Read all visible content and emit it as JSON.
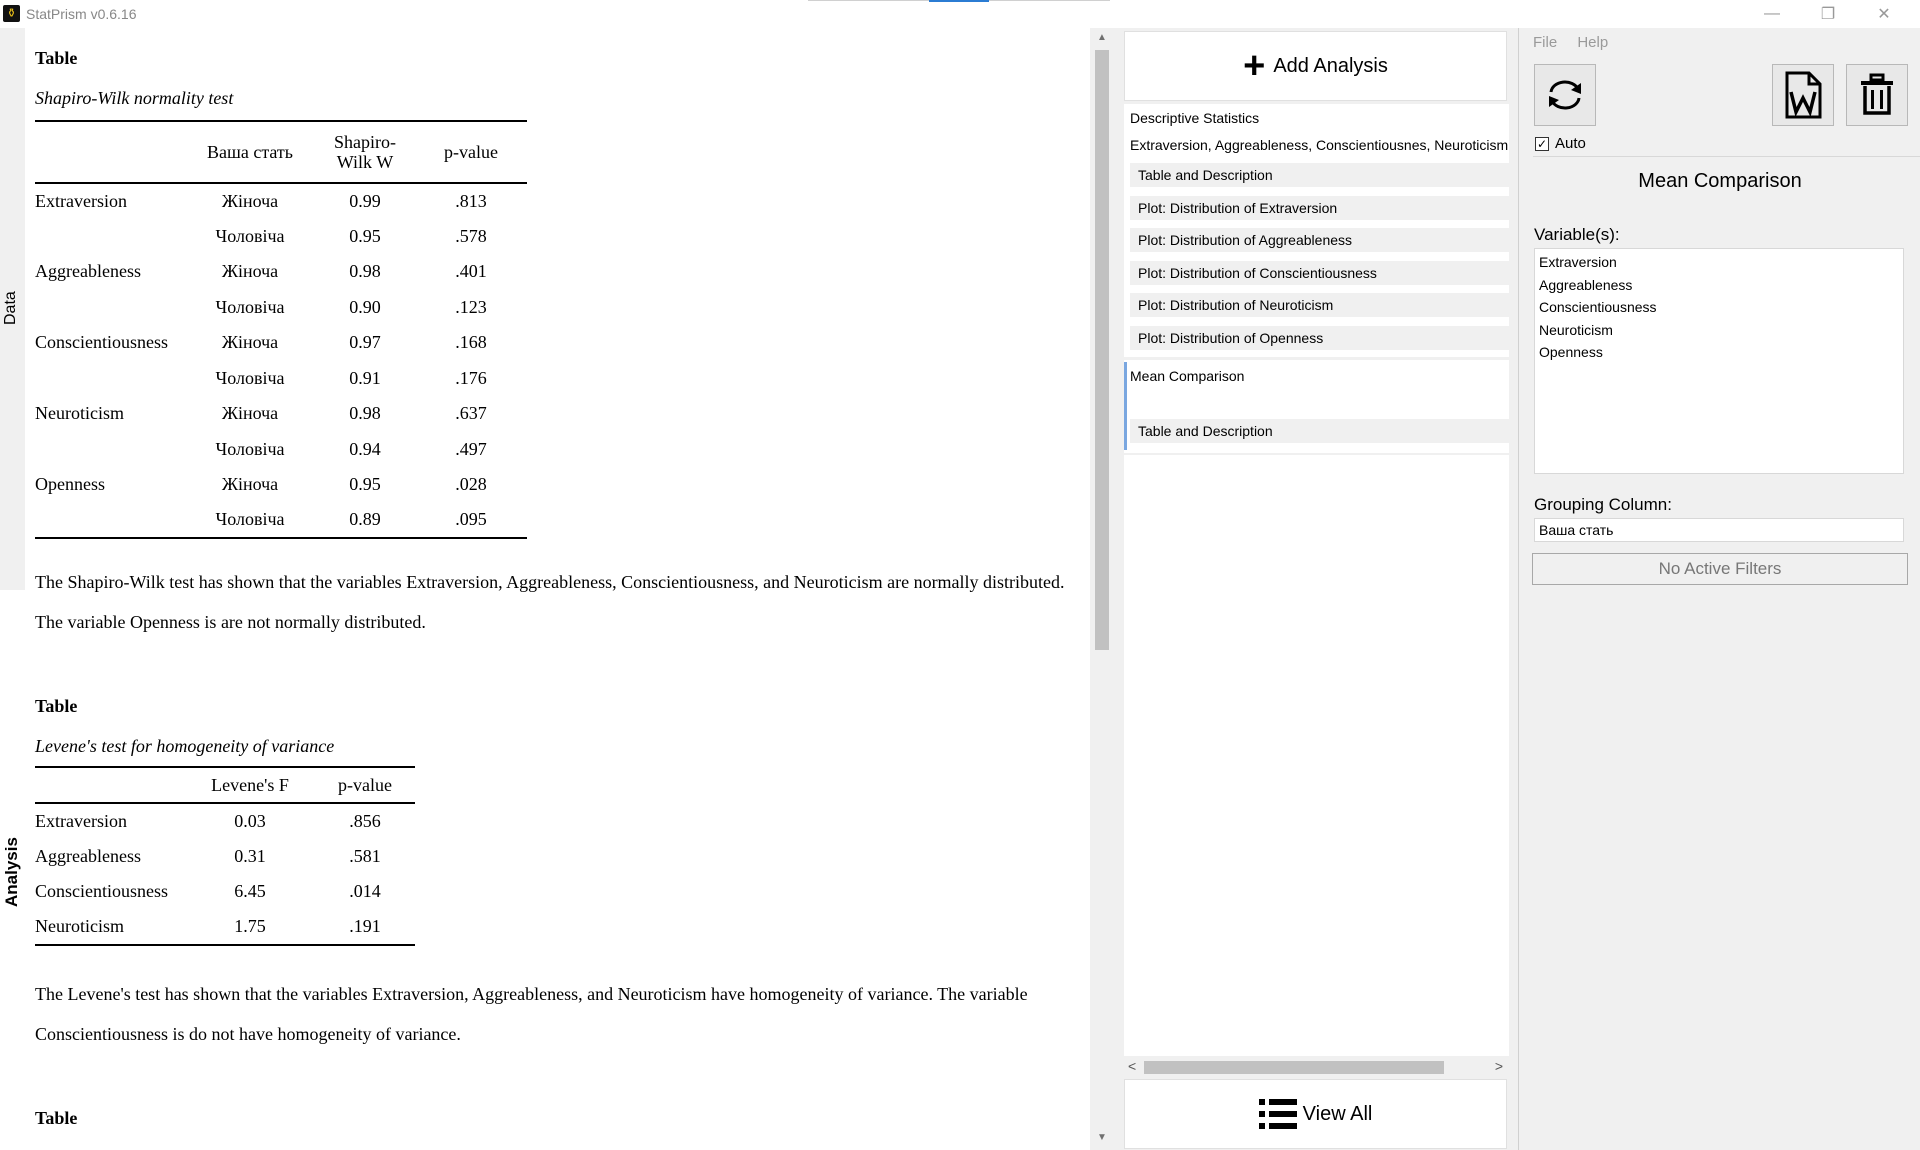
{
  "app": {
    "title": "StatPrism v0.6.16",
    "icon": "app-logo-icon"
  },
  "window_controls": {
    "minimize": "—",
    "restore": "❐",
    "close": "✕"
  },
  "left_tabs": {
    "data": "Data",
    "analysis": "Analysis"
  },
  "document": {
    "shapiro": {
      "label": "Table",
      "caption": "Shapiro-Wilk normality test",
      "headers": [
        "",
        "Ваша стать",
        "Shapiro-\nWilk W",
        "p-value"
      ],
      "rows": [
        [
          "Extraversion",
          "Жіноча",
          "0.99",
          ".813"
        ],
        [
          "",
          "Чоловіча",
          "0.95",
          ".578"
        ],
        [
          "Aggreableness",
          "Жіноча",
          "0.98",
          ".401"
        ],
        [
          "",
          "Чоловіча",
          "0.90",
          ".123"
        ],
        [
          "Conscientiousness",
          "Жіноча",
          "0.97",
          ".168"
        ],
        [
          "",
          "Чоловіча",
          "0.91",
          ".176"
        ],
        [
          "Neuroticism",
          "Жіноча",
          "0.98",
          ".637"
        ],
        [
          "",
          "Чоловіча",
          "0.94",
          ".497"
        ],
        [
          "Openness",
          "Жіноча",
          "0.95",
          ".028"
        ],
        [
          "",
          "Чоловіча",
          "0.89",
          ".095"
        ]
      ],
      "description": "The Shapiro-Wilk test has shown that the variables Extraversion, Aggreableness, Conscientiousness, and Neuroticism are normally distributed. The variable Openness is are not normally distributed."
    },
    "levene": {
      "label": "Table",
      "caption": "Levene's test for homogeneity of variance",
      "headers": [
        "",
        "Levene's F",
        "p-value"
      ],
      "rows": [
        [
          "Extraversion",
          "0.03",
          ".856"
        ],
        [
          "Aggreableness",
          "0.31",
          ".581"
        ],
        [
          "Conscientiousness",
          "6.45",
          ".014"
        ],
        [
          "Neuroticism",
          "1.75",
          ".191"
        ]
      ],
      "description": "The Levene's test has shown that the variables Extraversion, Aggreableness, and Neuroticism have homogeneity of variance. The variable Conscientiousness is do not have homogeneity of variance."
    },
    "next_label": "Table"
  },
  "analysis_list": {
    "add_label": "Add Analysis",
    "view_all_label": "View All",
    "groups": [
      {
        "title": "Descriptive Statistics",
        "subtitle": "Extraversion, Aggreableness, Conscientiousnes, Neuroticism",
        "items": [
          "Table and Description",
          "Plot: Distribution of Extraversion",
          "Plot: Distribution of Aggreableness",
          "Plot: Distribution of Conscientiousness",
          "Plot: Distribution of Neuroticism",
          "Plot: Distribution of Openness"
        ]
      },
      {
        "title": "Mean Comparison",
        "items": [
          "Table and Description"
        ]
      }
    ]
  },
  "settings_panel": {
    "menu": [
      "File",
      "Help"
    ],
    "buttons": {
      "refresh": "refresh-icon",
      "word": "word-document-icon",
      "delete": "trash-icon"
    },
    "auto_label": "Auto",
    "auto_checked": true,
    "title": "Mean Comparison",
    "variables_label": "Variable(s):",
    "variables": [
      "Extraversion",
      "Aggreableness",
      "Conscientiousness",
      "Neuroticism",
      "Openness"
    ],
    "grouping_label": "Grouping Column:",
    "grouping_value": "Ваша стать",
    "filters_label": "No Active Filters"
  }
}
